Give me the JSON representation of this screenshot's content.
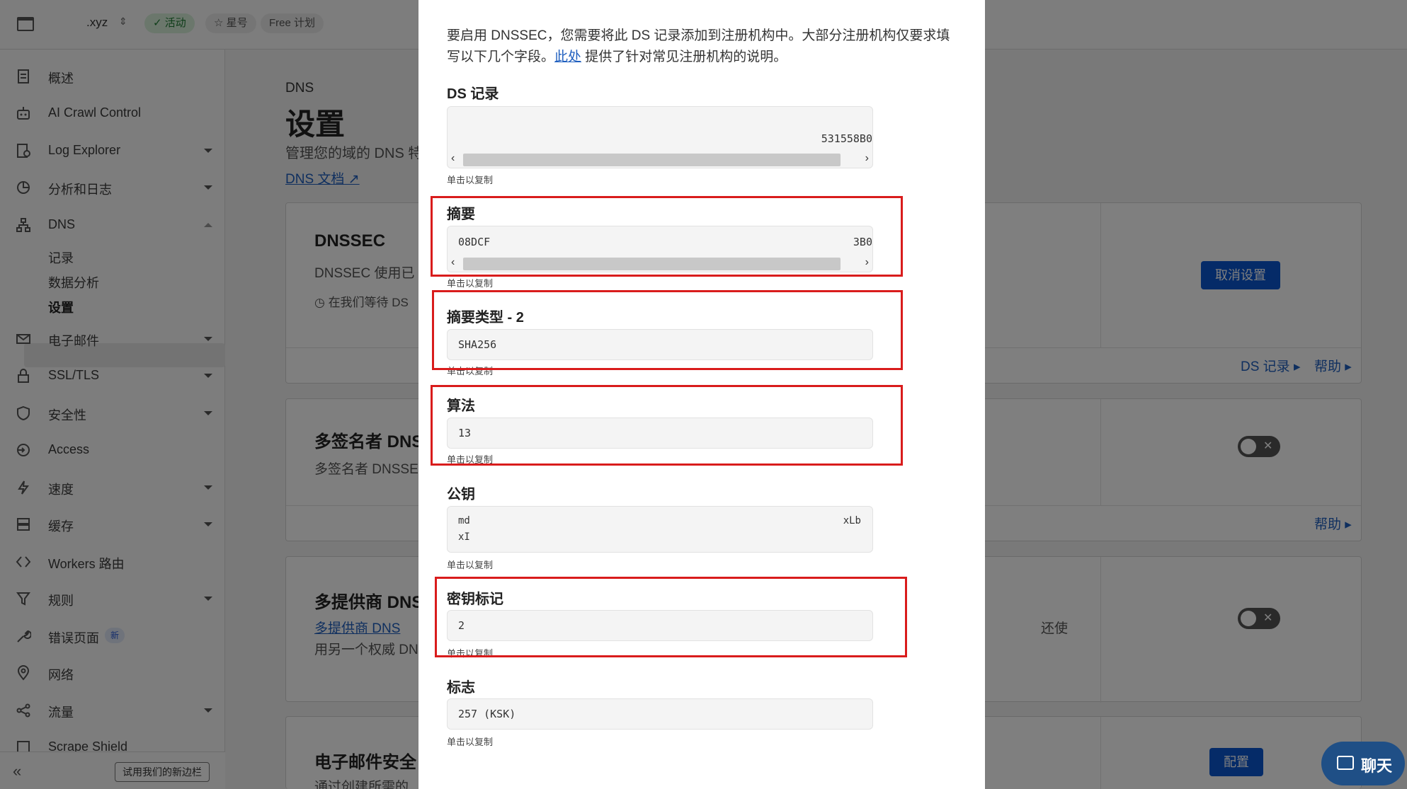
{
  "topbar": {
    "zone": ".xyz",
    "status_badge": "活动",
    "star_label": "星号",
    "plan_label": "Free 计划"
  },
  "sidebar": {
    "items": [
      {
        "label": "概述",
        "icon": "document-icon"
      },
      {
        "label": "AI Crawl Control",
        "icon": "robot-icon"
      },
      {
        "label": "Log Explorer",
        "icon": "log-icon"
      },
      {
        "label": "分析和日志",
        "icon": "chart-pie-icon"
      },
      {
        "label": "DNS",
        "icon": "network-icon"
      },
      {
        "label": "电子邮件",
        "icon": "mail-icon"
      },
      {
        "label": "SSL/TLS",
        "icon": "lock-icon"
      },
      {
        "label": "安全性",
        "icon": "shield-icon"
      },
      {
        "label": "Access",
        "icon": "access-icon"
      },
      {
        "label": "速度",
        "icon": "bolt-icon"
      },
      {
        "label": "缓存",
        "icon": "server-icon"
      },
      {
        "label": "Workers 路由",
        "icon": "code-icon"
      },
      {
        "label": "规则",
        "icon": "funnel-icon"
      },
      {
        "label": "错误页面",
        "icon": "wrench-icon"
      },
      {
        "label": "网络",
        "icon": "pin-icon"
      },
      {
        "label": "流量",
        "icon": "share-icon"
      },
      {
        "label": "Scrape Shield",
        "icon": "scrape-icon"
      }
    ],
    "dns_sub": [
      "记录",
      "数据分析",
      "设置"
    ],
    "new_badge": "新",
    "try_button": "试用我们的新边栏"
  },
  "main": {
    "section": "DNS",
    "title": "设置",
    "desc": "管理您的域的 DNS 特",
    "doc_link": "DNS 文档",
    "dnssec": {
      "title": "DNSSEC",
      "text": "DNSSEC 使用已",
      "waiting": "在我们等待 DS",
      "cancel_button": "取消设置",
      "ds_link": "DS 记录",
      "help_link": "帮助"
    },
    "multisigner": {
      "title": "多签名者 DNS",
      "text": "多签名者 DNSSE",
      "help_link": "帮助"
    },
    "multiprovider": {
      "title": "多提供商 DNS",
      "link": "多提供商 DNS",
      "text": "用另一个权威 DN",
      "right_fragment": "还使"
    },
    "email_security": {
      "title": "电子邮件安全",
      "text": "通过创建所需的",
      "config_button": "配置"
    }
  },
  "modal": {
    "intro_before_link": "要启用 DNSSEC，您需要将此 DS 记录添加到注册机构中。大部分注册机构仅要求填写以下几个字段。",
    "intro_link": "此处",
    "intro_after_link": " 提供了针对常见注册机构的说明。",
    "copy_hint": "单击以复制",
    "fields": {
      "ds_record": {
        "label": "DS 记录",
        "value_right": "531558B0"
      },
      "digest": {
        "label": "摘要",
        "value_left": "08DCF",
        "value_right": "3B0"
      },
      "digest_type": {
        "label": "摘要类型 - 2",
        "value": "SHA256"
      },
      "algorithm": {
        "label": "算法",
        "value": "13"
      },
      "public_key": {
        "label": "公钥",
        "line1_left": "md",
        "line1_right": "xLb",
        "line2": "xI"
      },
      "key_tag": {
        "label": "密钥标记",
        "value": "2"
      },
      "flags": {
        "label": "标志",
        "value": "257 (KSK)"
      }
    }
  },
  "chat": {
    "label": "聊天"
  },
  "colors": {
    "highlight": "#d91c1c",
    "accent": "#0b57d0",
    "link": "#1f5fbf"
  }
}
